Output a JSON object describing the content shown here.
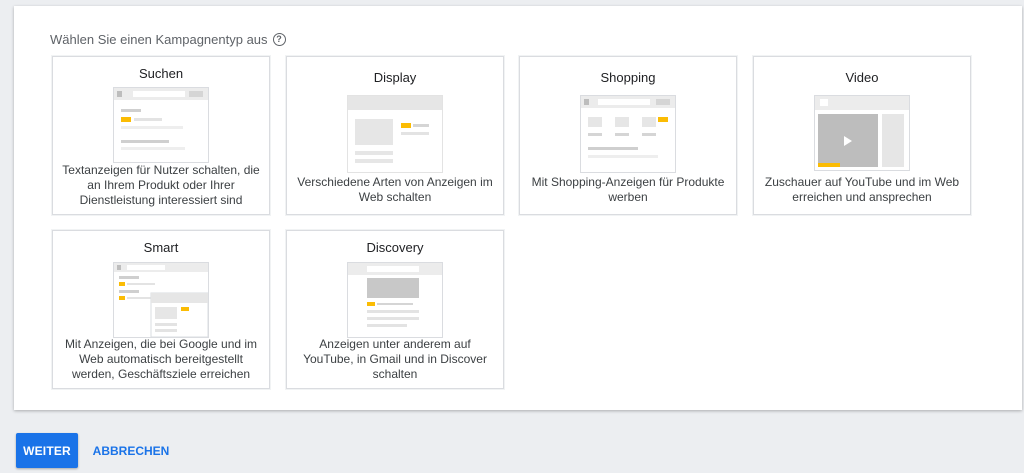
{
  "prompt": {
    "label": "Wählen Sie einen Kampagnentyp aus",
    "help_icon": "help-circle-icon"
  },
  "cards": [
    {
      "title": "Suchen",
      "description": "Textanzeigen für Nutzer schalten, die an Ihrem Produkt oder Ihrer Dienstleistung interessiert sind"
    },
    {
      "title": "Display",
      "description": "Verschiedene Arten von Anzeigen im Web schalten"
    },
    {
      "title": "Shopping",
      "description": "Mit Shopping-Anzeigen für Produkte werben"
    },
    {
      "title": "Video",
      "description": "Zuschauer auf YouTube und im Web erreichen und ansprechen"
    },
    {
      "title": "Smart",
      "description": "Mit Anzeigen, die bei Google und im Web automatisch bereitgestellt werden, Geschäftsziele erreichen"
    },
    {
      "title": "Discovery",
      "description": "Anzeigen unter anderem auf YouTube, in Gmail und in Discover schalten"
    }
  ],
  "buttons": {
    "continue": "WEITER",
    "cancel": "ABBRECHEN"
  },
  "colors": {
    "accent": "#1a73e8",
    "highlight": "#fbbc04",
    "illustration_gray": "#e0e0e0"
  }
}
